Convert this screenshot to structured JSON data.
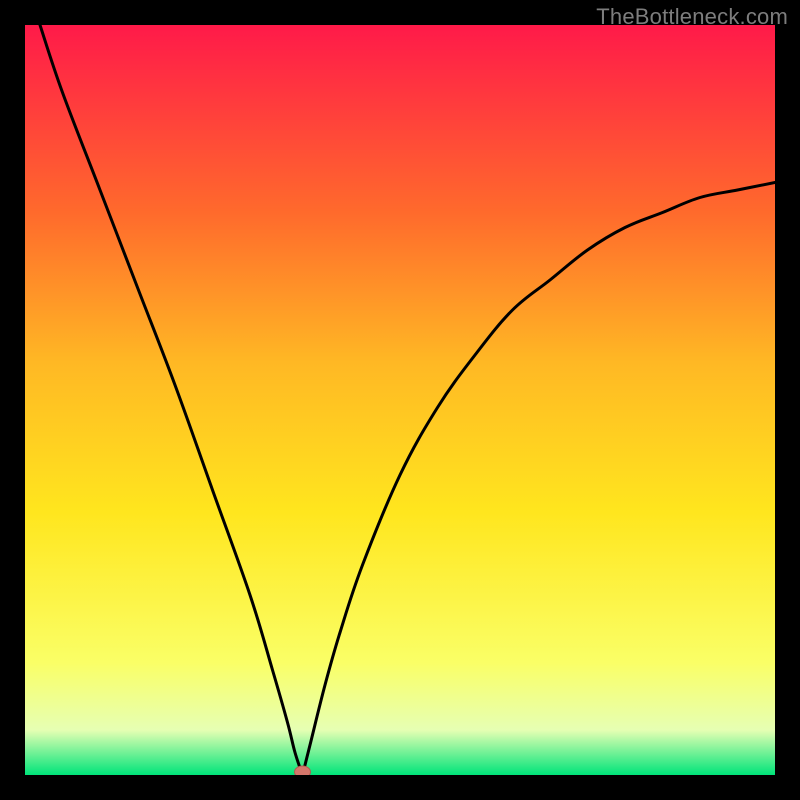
{
  "watermark": "TheBottleneck.com",
  "colors": {
    "frame": "#000000",
    "gradient_top": "#ff1a49",
    "gradient_mid1": "#ff6a2c",
    "gradient_mid2": "#ffb824",
    "gradient_mid3": "#ffe61e",
    "gradient_low1": "#faff66",
    "gradient_low2": "#e6ffb3",
    "gradient_bottom": "#00e47a",
    "curve": "#000000",
    "marker_fill": "#d4766b",
    "marker_stroke": "#b35a50"
  },
  "chart_data": {
    "type": "line",
    "title": "",
    "xlabel": "",
    "ylabel": "",
    "xlim": [
      0,
      100
    ],
    "ylim": [
      0,
      100
    ],
    "x_at_min": 37,
    "y_min": 0,
    "left_branch": [
      {
        "x": 2,
        "y": 100
      },
      {
        "x": 5,
        "y": 91
      },
      {
        "x": 10,
        "y": 78
      },
      {
        "x": 15,
        "y": 65
      },
      {
        "x": 20,
        "y": 52
      },
      {
        "x": 25,
        "y": 38
      },
      {
        "x": 30,
        "y": 24
      },
      {
        "x": 33,
        "y": 14
      },
      {
        "x": 35,
        "y": 7
      },
      {
        "x": 36,
        "y": 3
      },
      {
        "x": 37,
        "y": 0
      }
    ],
    "right_branch": [
      {
        "x": 37,
        "y": 0
      },
      {
        "x": 38,
        "y": 4
      },
      {
        "x": 40,
        "y": 12
      },
      {
        "x": 42,
        "y": 19
      },
      {
        "x": 45,
        "y": 28
      },
      {
        "x": 50,
        "y": 40
      },
      {
        "x": 55,
        "y": 49
      },
      {
        "x": 60,
        "y": 56
      },
      {
        "x": 65,
        "y": 62
      },
      {
        "x": 70,
        "y": 66
      },
      {
        "x": 75,
        "y": 70
      },
      {
        "x": 80,
        "y": 73
      },
      {
        "x": 85,
        "y": 75
      },
      {
        "x": 90,
        "y": 77
      },
      {
        "x": 95,
        "y": 78
      },
      {
        "x": 100,
        "y": 79
      }
    ],
    "marker": {
      "x": 37,
      "y": 0
    }
  }
}
